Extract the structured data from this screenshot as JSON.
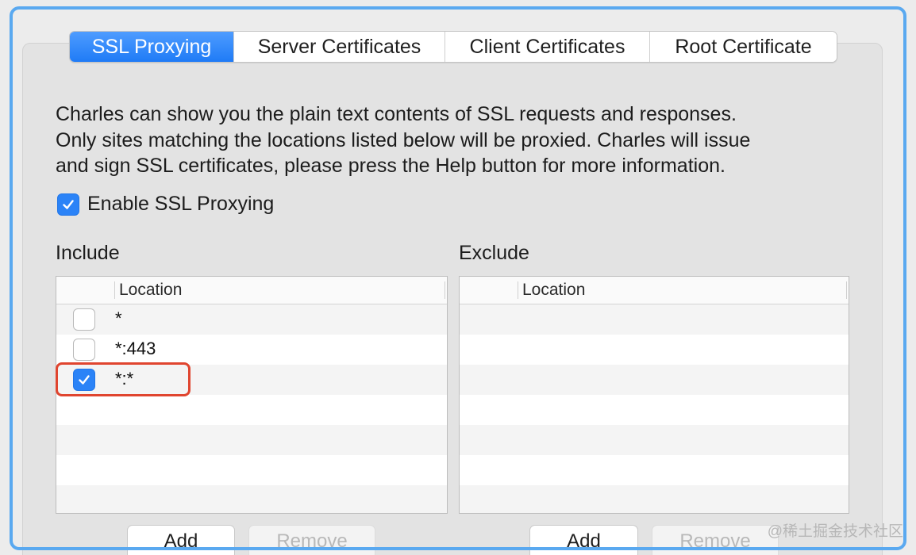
{
  "tabs": [
    {
      "label": "SSL Proxying",
      "active": true
    },
    {
      "label": "Server Certificates",
      "active": false
    },
    {
      "label": "Client Certificates",
      "active": false
    },
    {
      "label": "Root Certificate",
      "active": false
    }
  ],
  "description": [
    "Charles can show you the plain text contents of SSL requests and responses.",
    "Only sites matching the locations listed below will be proxied. Charles will issue",
    "and sign SSL certificates, please press the Help button for more information."
  ],
  "enable": {
    "label": "Enable SSL Proxying",
    "checked": true
  },
  "include": {
    "label": "Include",
    "column": "Location",
    "rows": [
      {
        "location": "*",
        "checked": false
      },
      {
        "location": "*:443",
        "checked": false
      },
      {
        "location": "*:*",
        "checked": true
      }
    ],
    "add_label": "Add",
    "remove_label": "Remove"
  },
  "exclude": {
    "label": "Exclude",
    "column": "Location",
    "rows": [],
    "add_label": "Add",
    "remove_label": "Remove"
  },
  "watermark": "@稀土掘金技术社区",
  "colors": {
    "accent": "#2b83f7",
    "highlight": "#e0452f",
    "focus_ring": "#5aa9f0"
  }
}
